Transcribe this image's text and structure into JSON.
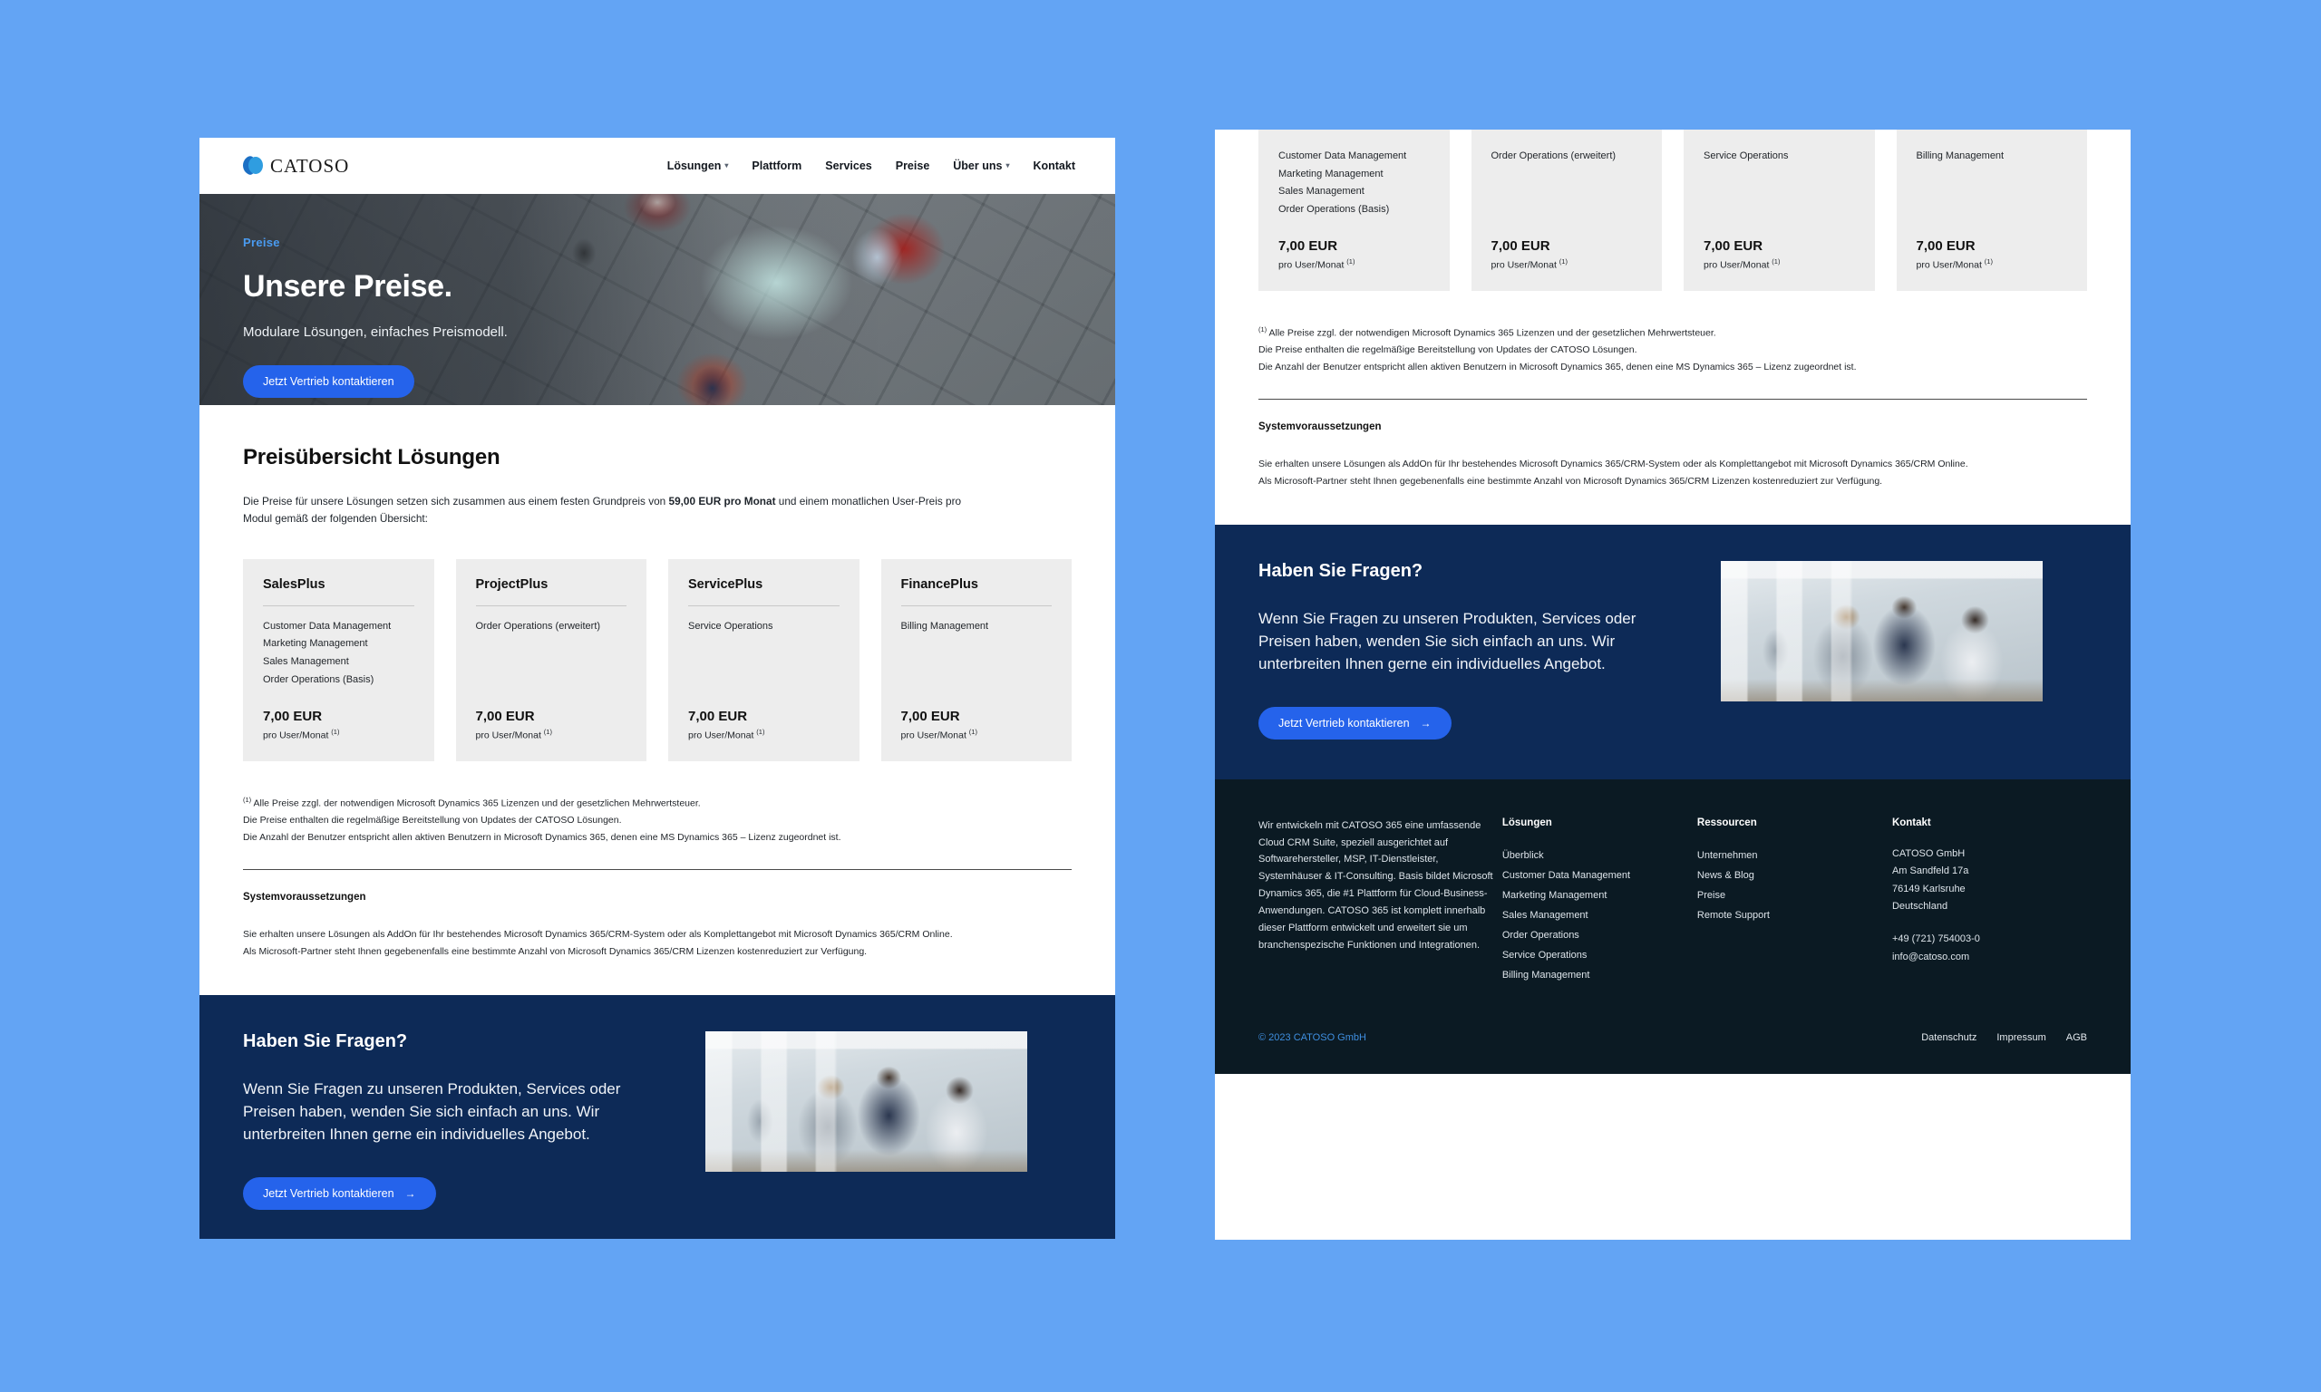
{
  "brand": {
    "name": "CATOSO",
    "accent": "#2563eb",
    "eyebrow_color": "#4a9bf0",
    "cta_bg": "#0d2a57",
    "footer_bg": "#0b1a23"
  },
  "nav": {
    "items": [
      {
        "label": "Lösungen",
        "has_caret": true,
        "icon": "chevron-down-icon"
      },
      {
        "label": "Plattform",
        "has_caret": false
      },
      {
        "label": "Services",
        "has_caret": false
      },
      {
        "label": "Preise",
        "has_caret": false
      },
      {
        "label": "Über uns",
        "has_caret": true,
        "icon": "chevron-down-icon"
      },
      {
        "label": "Kontakt",
        "has_caret": false
      }
    ]
  },
  "hero": {
    "eyebrow": "Preise",
    "title": "Unsere Preise.",
    "subtitle": "Modulare Lösungen, einfaches Preismodell.",
    "cta_label": "Jetzt Vertrieb kontaktieren"
  },
  "pricing": {
    "title": "Preisübersicht Lösungen",
    "intro_a": "Die Preise für unsere Lösungen setzen sich zusammen aus einem festen Grundpreis von ",
    "intro_bold": "59,00 EUR pro Monat",
    "intro_b": " und einem monatlichen User-Preis pro Modul gemäß der folgenden Übersicht:",
    "cards": [
      {
        "title": "SalesPlus",
        "features": [
          "Customer Data Management",
          "Marketing Management",
          "Sales Management",
          "Order Operations (Basis)"
        ],
        "price": "7,00 EUR",
        "per": "pro User/Monat",
        "footnote_mark": "(1)"
      },
      {
        "title": "ProjectPlus",
        "features": [
          "Order Operations (erweitert)"
        ],
        "price": "7,00 EUR",
        "per": "pro User/Monat",
        "footnote_mark": "(1)"
      },
      {
        "title": "ServicePlus",
        "features": [
          "Service Operations"
        ],
        "price": "7,00 EUR",
        "per": "pro User/Monat",
        "footnote_mark": "(1)"
      },
      {
        "title": "FinancePlus",
        "features": [
          "Billing Management"
        ],
        "price": "7,00 EUR",
        "per": "pro User/Monat",
        "footnote_mark": "(1)"
      }
    ],
    "footnote_mark": "(1)",
    "footnote_line1": " Alle Preise zzgl. der notwendigen Microsoft Dynamics 365 Lizenzen und der gesetzlichen Mehrwertsteuer.",
    "footnote_line2": "Die Preise enthalten die regelmäßige Bereitstellung von Updates der CATOSO Lösungen.",
    "footnote_line3": "Die Anzahl der Benutzer entspricht allen aktiven Benutzern in Microsoft Dynamics 365, denen eine MS Dynamics 365 – Lizenz zugeordnet ist.",
    "sysreq_title": "Systemvoraussetzungen",
    "sysreq_line1": "Sie erhalten unsere Lösungen als AddOn für Ihr bestehendes Microsoft Dynamics 365/CRM-System oder als Komplettangebot mit Microsoft Dynamics 365/CRM Online.",
    "sysreq_line2": "Als Microsoft-Partner steht Ihnen gegebenenfalls eine bestimmte Anzahl von Microsoft Dynamics 365/CRM Lizenzen kostenreduziert zur Verfügung."
  },
  "cta": {
    "title": "Haben Sie Fragen?",
    "body": "Wenn Sie Fragen zu unseren Produkten, Services oder Preisen haben, wenden Sie sich einfach an uns. Wir unterbreiten Ihnen gerne ein individuelles Angebot.",
    "button_label": "Jetzt Vertrieb kontaktieren",
    "button_arrow": "→"
  },
  "footer": {
    "about": "Wir entwickeln mit CATOSO 365 eine umfassende Cloud CRM Suite, speziell ausgerichtet auf Softwarehersteller, MSP, IT-Dienstleister, Systemhäuser & IT-Consulting. Basis bildet Microsoft Dynamics 365, die #1 Plattform für Cloud-Business-Anwendungen. CATOSO 365 ist komplett innerhalb dieser Plattform entwickelt und erweitert sie um branchenspezische Funktionen und Integrationen.",
    "col_solutions": {
      "heading": "Lösungen",
      "items": [
        "Überblick",
        "Customer Data Management",
        "Marketing Management",
        "Sales Management",
        "Order Operations",
        "Service Operations",
        "Billing Management"
      ]
    },
    "col_resources": {
      "heading": "Ressourcen",
      "items": [
        "Unternehmen",
        "News & Blog",
        "Preise",
        "Remote Support"
      ]
    },
    "col_contact": {
      "heading": "Kontakt",
      "company": "CATOSO GmbH",
      "street": "Am Sandfeld 17a",
      "city": "76149 Karlsruhe",
      "country": "Deutschland",
      "phone": "+49 (721) 754003-0",
      "email": "info@catoso.com"
    },
    "copyright": "© 2023 CATOSO GmbH",
    "legal": [
      "Datenschutz",
      "Impressum",
      "AGB"
    ]
  }
}
